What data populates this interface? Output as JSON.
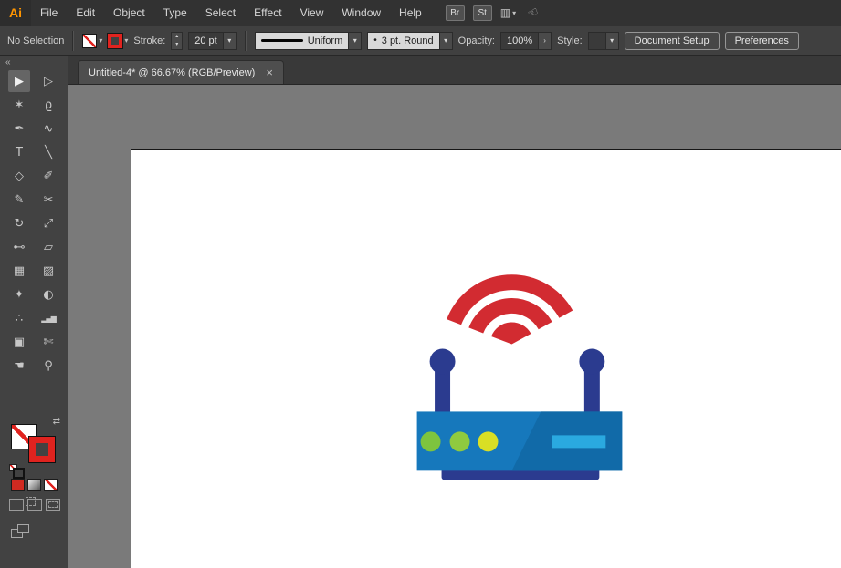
{
  "menu_bar": {
    "logo": "Ai",
    "items": [
      "File",
      "Edit",
      "Object",
      "Type",
      "Select",
      "Effect",
      "View",
      "Window",
      "Help"
    ],
    "bridge": "Br",
    "stock": "St"
  },
  "control_bar": {
    "no_selection": "No Selection",
    "stroke_label": "Stroke:",
    "stroke_size": "20 pt",
    "width_profile": "Uniform",
    "brush": "3 pt. Round",
    "opacity_label": "Opacity:",
    "opacity": "100%",
    "style_label": "Style:",
    "document_setup": "Document Setup",
    "preferences": "Preferences"
  },
  "document_tab": {
    "title": "Untitled-4* @ 66.67% (RGB/Preview)"
  },
  "icons": {
    "chevron_down": "▾",
    "chevron_right": "›",
    "stepper_up": "▴",
    "stepper_down": "▾",
    "collapse": "«",
    "swap": "⇄",
    "close": "×",
    "workspace_grid": "▥",
    "hand_gesture": "☜",
    "brush_dot": "•"
  },
  "toolbar": {
    "tools": [
      {
        "name": "selection-tool",
        "glyph": "▶",
        "active": true
      },
      {
        "name": "direct-selection-tool",
        "glyph": "▷"
      },
      {
        "name": "magic-wand-tool",
        "glyph": "✶"
      },
      {
        "name": "lasso-tool",
        "glyph": "ϱ"
      },
      {
        "name": "pen-tool",
        "glyph": "✒"
      },
      {
        "name": "curvature-tool",
        "glyph": "∿"
      },
      {
        "name": "type-tool",
        "glyph": "T"
      },
      {
        "name": "line-segment-tool",
        "glyph": "╲"
      },
      {
        "name": "polygon-tool",
        "glyph": "◇"
      },
      {
        "name": "paintbrush-tool",
        "glyph": "✐"
      },
      {
        "name": "pencil-tool",
        "glyph": "✎"
      },
      {
        "name": "scissors-tool",
        "glyph": "✂"
      },
      {
        "name": "rotate-tool",
        "glyph": "↻"
      },
      {
        "name": "scale-tool",
        "glyph": "⤢"
      },
      {
        "name": "width-tool",
        "glyph": "⊷"
      },
      {
        "name": "free-transform-tool",
        "glyph": "▱"
      },
      {
        "name": "mesh-tool",
        "glyph": "▦"
      },
      {
        "name": "gradient-tool",
        "glyph": "▨"
      },
      {
        "name": "eyedropper-tool",
        "glyph": "✦"
      },
      {
        "name": "blend-tool",
        "glyph": "◐"
      },
      {
        "name": "symbol-sprayer-tool",
        "glyph": "∴"
      },
      {
        "name": "column-graph-tool",
        "glyph": "▂▄▆"
      },
      {
        "name": "artboard-tool",
        "glyph": "▣"
      },
      {
        "name": "slice-tool",
        "glyph": "✄"
      },
      {
        "name": "hand-tool",
        "glyph": "☚"
      },
      {
        "name": "zoom-tool",
        "glyph": "⚲"
      }
    ],
    "fill_type": "none",
    "stroke_color": "#e0231f"
  },
  "artwork": {
    "name": "wifi-router-icon",
    "colors": {
      "signal_red": "#d22b31",
      "body_blue": "#1678bc",
      "body_shade_blue": "#116aa8",
      "display_bar_blue": "#2aa9e0",
      "antenna_navy": "#2b3b8f",
      "led_green_1": "#7ec43e",
      "led_green_2": "#8fca3f",
      "led_yellow": "#d9df25"
    }
  },
  "ui_colors": {
    "menubar_bg": "#323232",
    "panel_bg": "#424242",
    "canvas_gray": "#7a7a7a",
    "artboard_white": "#ffffff",
    "accent_red": "#e0231f",
    "logo_orange": "#ff9500"
  }
}
